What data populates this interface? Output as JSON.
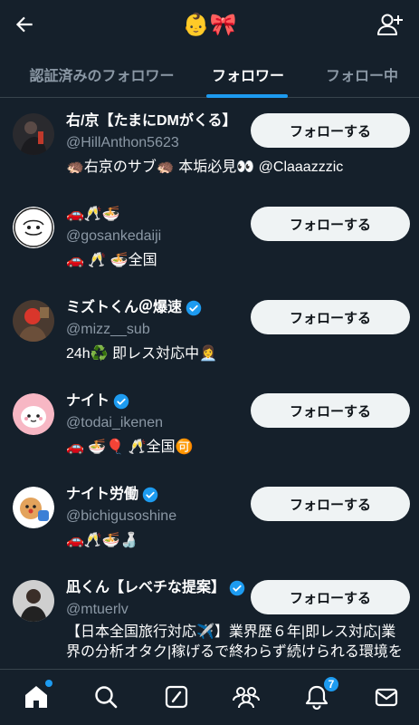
{
  "header": {
    "title": "👶🎀"
  },
  "tabs": [
    {
      "label": "認証済みのフォロワー"
    },
    {
      "label": "フォロワー"
    },
    {
      "label": "フォロー中"
    }
  ],
  "colors": {
    "background": "#15202b",
    "accent": "#1d9bf0",
    "secondary_text": "#8b98a5",
    "button_bg": "#eff3f4"
  },
  "users": [
    {
      "name": "右/京【たまにDMがくる】",
      "verified": false,
      "handle": "@HillAnthon5623",
      "bio": "🦔右京のサブ🦔 本垢必見👀 @Claaazzzic",
      "follow_label": "フォローする"
    },
    {
      "name": "🚗🥂🍜",
      "verified": false,
      "handle": "@gosankedaiji",
      "bio": "🚗 🥂 🍜全国",
      "follow_label": "フォローする"
    },
    {
      "name": "ミズトくん＠爆速",
      "verified": true,
      "handle": "@mizz__sub",
      "bio": "24h♻️ 即レス対応中👩‍💼",
      "follow_label": "フォローする"
    },
    {
      "name": "ナイト",
      "verified": true,
      "handle": "@todai_ikenen",
      "bio": "🚗 🍜🎈 🥂全国🉑",
      "follow_label": "フォローする"
    },
    {
      "name": "ナイト労働",
      "verified": true,
      "handle": "@bichigusoshine",
      "bio": "🚗🥂🍜🍶",
      "follow_label": "フォローする"
    },
    {
      "name": "凪くん【レベチな提案】",
      "verified": true,
      "handle": "@mtuerlv",
      "bio": "【日本全国旅行対応✈️】業界歴６年|即レス対応|業界の分析オタク|稼げるで終わらず続けられる環境を",
      "follow_label": "フォローする"
    }
  ],
  "nav": {
    "home_icon": "home-icon",
    "search_icon": "search-icon",
    "compose_icon": "compose-icon",
    "communities_icon": "communities-icon",
    "notifications_icon": "bell-icon",
    "notifications_count": "7",
    "messages_icon": "mail-icon"
  }
}
